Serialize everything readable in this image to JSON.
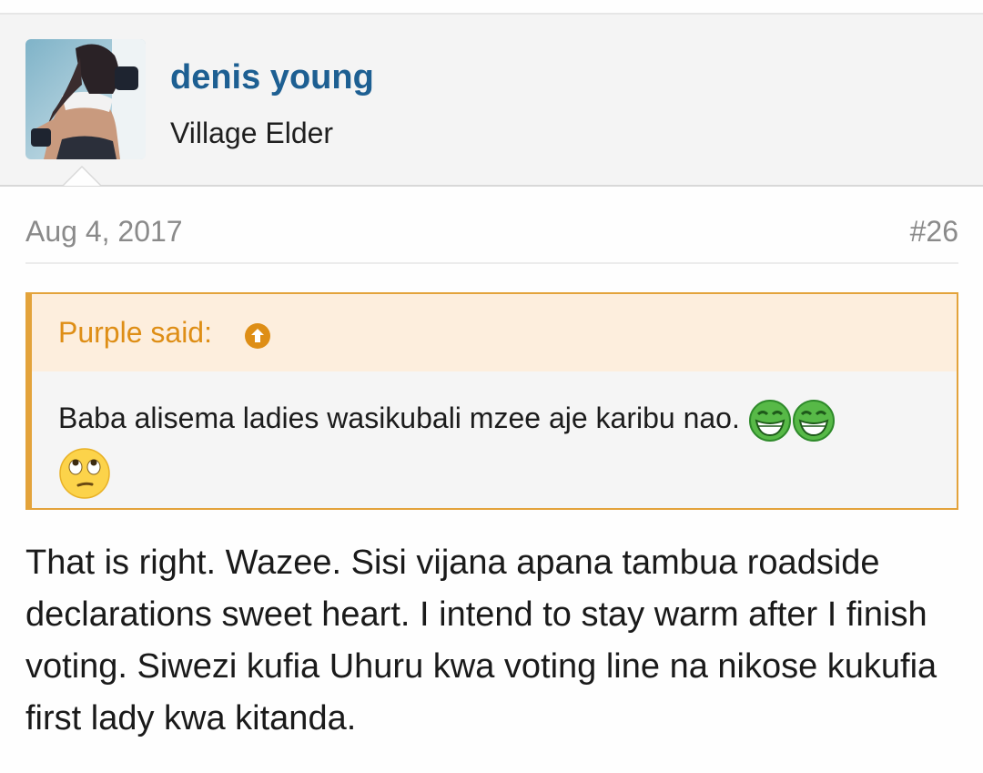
{
  "user": {
    "name": "denis young",
    "title": "Village Elder",
    "avatar": "avatar-photo"
  },
  "post": {
    "date": "Aug 4, 2017",
    "number": "#26",
    "body": "That is right. Wazee. Sisi vijana apana tambua roadside declarations sweet heart. I intend to stay warm after I finish voting. Siwezi kufia Uhuru kwa voting line na nikose kukufia first lady kwa kitanda."
  },
  "quote": {
    "author_label": "Purple said:",
    "arrow_icon": "up-arrow-circle-icon",
    "text": "Baba alisema ladies wasikubali mzee aje karibu nao.",
    "emojis": [
      "grinning-face-green-icon",
      "grinning-face-green-icon",
      "eye-roll-emoji-icon"
    ]
  },
  "colors": {
    "username": "#1d5f92",
    "quote_accent": "#e3a33b",
    "quote_author": "#de8e16",
    "header_bg": "#f4f4f4",
    "quote_head_bg": "#fdeedd"
  }
}
